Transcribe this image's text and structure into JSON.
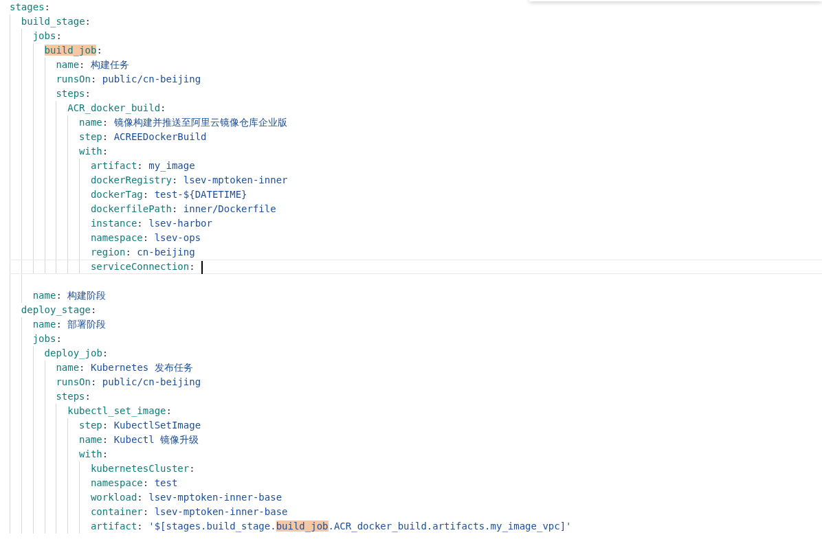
{
  "separator": ":",
  "lines": [
    {
      "key": "stages",
      "highlighted": false,
      "current": false,
      "children": [
        {
          "key": "build_stage",
          "highlighted": false,
          "current": false,
          "children": [
            {
              "key": "jobs",
              "highlighted": false,
              "current": false,
              "children": [
                {
                  "key": "build_job",
                  "highlighted": true,
                  "current": false,
                  "children": [
                    {
                      "key": "name",
                      "value": "构建任务",
                      "highlighted": false,
                      "current": false
                    },
                    {
                      "key": "runsOn",
                      "value": "public/cn-beijing",
                      "highlighted": false,
                      "current": false
                    },
                    {
                      "key": "steps",
                      "highlighted": false,
                      "current": false,
                      "children": [
                        {
                          "key": "ACR_docker_build",
                          "highlighted": false,
                          "current": false,
                          "children": [
                            {
                              "key": "name",
                              "value": "镜像构建并推送至阿里云镜像仓库企业版",
                              "highlighted": false,
                              "current": false
                            },
                            {
                              "key": "step",
                              "value": "ACREEDockerBuild",
                              "highlighted": false,
                              "current": false
                            },
                            {
                              "key": "with",
                              "highlighted": false,
                              "current": false,
                              "children": [
                                {
                                  "key": "artifact",
                                  "value": "my_image",
                                  "highlighted": false,
                                  "current": false
                                },
                                {
                                  "key": "dockerRegistry",
                                  "value": "lsev-mptoken-inner",
                                  "highlighted": false,
                                  "current": false
                                },
                                {
                                  "key": "dockerTag",
                                  "value": "test-${DATETIME}",
                                  "highlighted": false,
                                  "current": false
                                },
                                {
                                  "key": "dockerfilePath",
                                  "value": "inner/Dockerfile",
                                  "highlighted": false,
                                  "current": false
                                },
                                {
                                  "key": "instance",
                                  "value": "lsev-harbor",
                                  "highlighted": false,
                                  "current": false
                                },
                                {
                                  "key": "namespace",
                                  "value": "lsev-ops",
                                  "highlighted": false,
                                  "current": false
                                },
                                {
                                  "key": "region",
                                  "value": "cn-beijing",
                                  "highlighted": false,
                                  "current": false
                                },
                                {
                                  "key": "serviceConnection",
                                  "highlighted": false,
                                  "current": true
                                }
                              ]
                            }
                          ]
                        }
                      ]
                    }
                  ]
                }
              ]
            },
            {
              "key": "name",
              "value": "构建阶段",
              "highlighted": false,
              "current": false,
              "blank_before": true
            }
          ]
        },
        {
          "key": "deploy_stage",
          "highlighted": false,
          "current": false,
          "children": [
            {
              "key": "name",
              "value": "部署阶段",
              "highlighted": false,
              "current": false
            },
            {
              "key": "jobs",
              "highlighted": false,
              "current": false,
              "children": [
                {
                  "key": "deploy_job",
                  "highlighted": false,
                  "current": false,
                  "children": [
                    {
                      "key": "name",
                      "value": "Kubernetes 发布任务",
                      "highlighted": false,
                      "current": false
                    },
                    {
                      "key": "runsOn",
                      "value": "public/cn-beijing",
                      "highlighted": false,
                      "current": false
                    },
                    {
                      "key": "steps",
                      "highlighted": false,
                      "current": false,
                      "children": [
                        {
                          "key": "kubectl_set_image",
                          "highlighted": false,
                          "current": false,
                          "children": [
                            {
                              "key": "step",
                              "value": "KubectlSetImage",
                              "highlighted": false,
                              "current": false
                            },
                            {
                              "key": "name",
                              "value": "Kubectl 镜像升级",
                              "highlighted": false,
                              "current": false
                            },
                            {
                              "key": "with",
                              "highlighted": false,
                              "current": false,
                              "children": [
                                {
                                  "key": "kubernetesCluster",
                                  "highlighted": false,
                                  "current": false
                                },
                                {
                                  "key": "namespace",
                                  "value": "test",
                                  "highlighted": false,
                                  "current": false
                                },
                                {
                                  "key": "workload",
                                  "value": "lsev-mptoken-inner-base",
                                  "highlighted": false,
                                  "current": false
                                },
                                {
                                  "key": "container",
                                  "value": "lsev-mptoken-inner-base",
                                  "highlighted": false,
                                  "current": false
                                },
                                {
                                  "key": "artifact",
                                  "highlighted": false,
                                  "current": false,
                                  "value_parts": [
                                    {
                                      "text": "'$[stages.build_stage.",
                                      "highlighted": false
                                    },
                                    {
                                      "text": "build_job",
                                      "highlighted": true
                                    },
                                    {
                                      "text": ".ACR_docker_build.artifacts.my_image_vpc]'",
                                      "highlighted": false
                                    }
                                  ]
                                }
                              ]
                            }
                          ]
                        }
                      ]
                    }
                  ]
                }
              ]
            }
          ]
        }
      ]
    }
  ]
}
